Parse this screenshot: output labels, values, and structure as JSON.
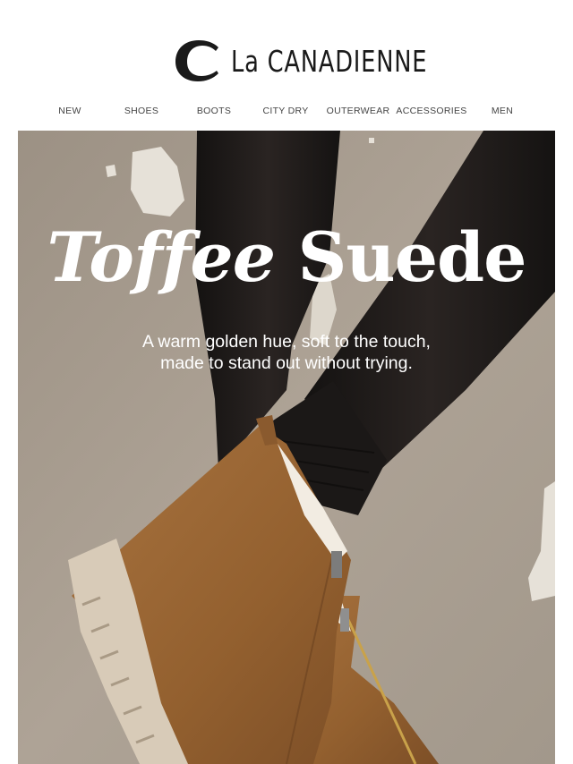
{
  "brand": {
    "logo_text": "La CANADIENNE"
  },
  "nav": {
    "items": [
      {
        "label": "NEW"
      },
      {
        "label": "SHOES"
      },
      {
        "label": "BOOTS"
      },
      {
        "label": "CITY DRY"
      },
      {
        "label": "OUTERWEAR"
      },
      {
        "label": "ACCESSORIES"
      },
      {
        "label": "MEN"
      }
    ]
  },
  "hero": {
    "headline_italic": "Toffee",
    "headline_regular": "Suede",
    "subline_1": "A warm golden hue, soft to the touch,",
    "subline_2": "made to stand out without trying."
  },
  "colors": {
    "background": "#ffffff",
    "wall": "#a69c90",
    "suede": "#9a6536",
    "tights": "#1a1716",
    "sole": "#d8cbb8"
  }
}
